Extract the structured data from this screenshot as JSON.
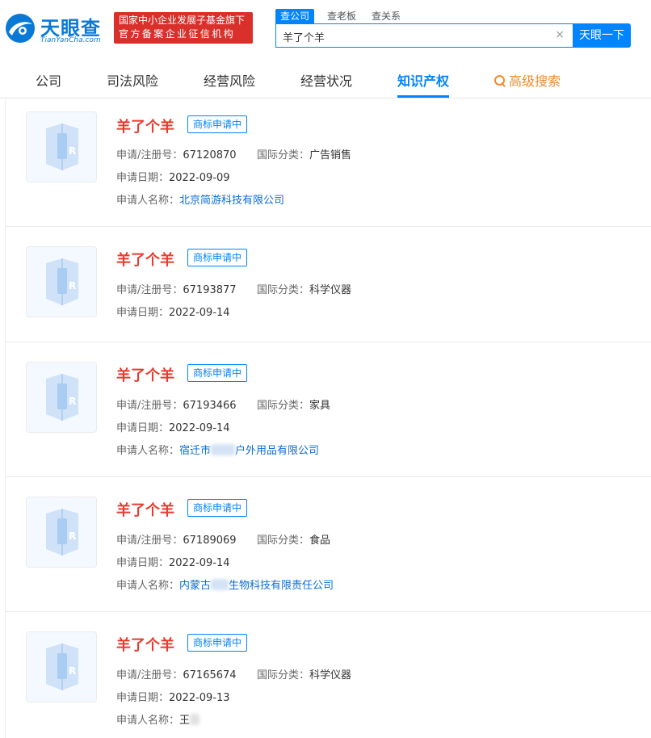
{
  "header": {
    "logo_cn": "天眼查",
    "logo_en": "TianYanCha.com",
    "badge_line1": "国家中小企业发展子基金旗下",
    "badge_line2": "官方备案企业征信机构",
    "search_tabs": [
      "查公司",
      "查老板",
      "查关系"
    ],
    "search_value": "羊了个羊",
    "clear_glyph": "×",
    "search_button": "天眼一下"
  },
  "nav": {
    "items": [
      "公司",
      "司法风险",
      "经营风险",
      "经营状况",
      "知识产权"
    ],
    "active": "知识产权",
    "advanced": "高级搜索"
  },
  "labels": {
    "reg_no": "申请/注册号：",
    "intl_class": "国际分类：",
    "apply_date": "申请日期：",
    "applicant": "申请人名称："
  },
  "trademarks": [
    {
      "name": "羊了个羊",
      "status": "商标申请中",
      "reg_no": "67120870",
      "intl_class": "广告销售",
      "apply_date": "2022-09-09",
      "applicant": "北京简游科技有限公司"
    },
    {
      "name": "羊了个羊",
      "status": "商标申请中",
      "reg_no": "67193877",
      "intl_class": "科学仪器",
      "apply_date": "2022-09-14"
    },
    {
      "name": "羊了个羊",
      "status": "商标申请中",
      "reg_no": "67193466",
      "intl_class": "家具",
      "apply_date": "2022-09-14",
      "applicant_pre": "宿迁市",
      "applicant_post": "户外用品有限公司"
    },
    {
      "name": "羊了个羊",
      "status": "商标申请中",
      "reg_no": "67189069",
      "intl_class": "食品",
      "apply_date": "2022-09-14",
      "applicant_pre": "内蒙古",
      "applicant_post": "生物科技有限责任公司"
    },
    {
      "name": "羊了个羊",
      "status": "商标申请中",
      "reg_no": "67165674",
      "intl_class": "科学仪器",
      "apply_date": "2022-09-13",
      "applicant_pre": "王"
    }
  ],
  "colors": {
    "brand_blue": "#0084FF",
    "trademark_red": "#E63B2E",
    "badge_red": "#D9302B",
    "advanced_orange": "#F08C2C"
  }
}
